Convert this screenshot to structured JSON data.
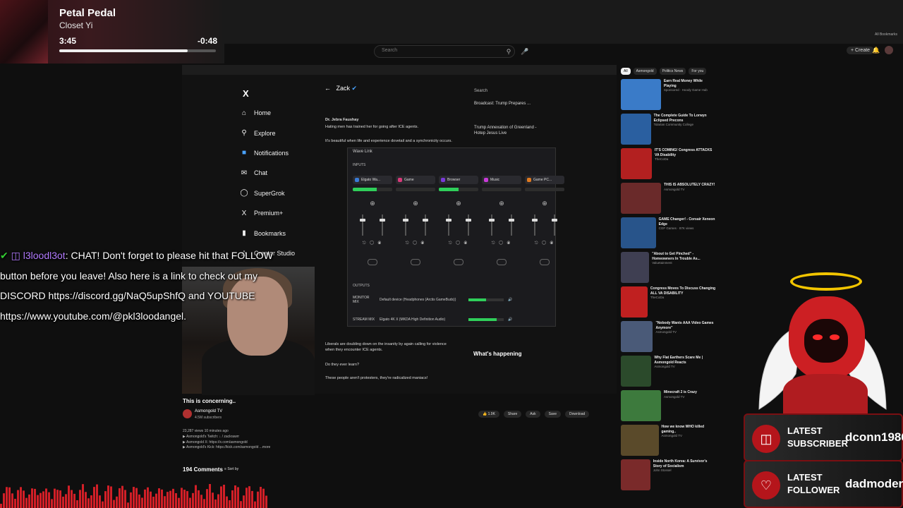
{
  "now_playing": {
    "title": "Petal Pedal",
    "artist": "Closet Yi",
    "elapsed": "3:45",
    "remaining": "-0:48",
    "progress": 0.82
  },
  "youtube": {
    "search_placeholder": "Search",
    "create_label": "Create",
    "bookmarks_label": "All Bookmarks",
    "video_title": "This is concerning..",
    "channel_name": "Asmongold TV",
    "channel_subs": "4.5M subscribers",
    "like_count": "1.9K",
    "actions": [
      "Share",
      "Ask",
      "Save",
      "Download"
    ],
    "description_lines": [
      "23,287 views  10 minutes ago",
      "▶ Asmongold's Twitch: ↓ / zackrawrr",
      "▶ Asmongold X: https://x.com/asmongold",
      "▶ Asmongold's Kick: https://kick.com/asmongold ...more"
    ],
    "comments_count": "194 Comments",
    "sort_label": "Sort by",
    "chips": [
      "All",
      "Asmongold",
      "Politics News",
      "For you"
    ],
    "recommendations": [
      {
        "title": "Earn Real Money While Playing",
        "meta": "Sponsored · Hoody Game Hub",
        "color": "#3a7bc8"
      },
      {
        "title": "The Complete Guide To Lorwyn Eclipsed Precons",
        "meta": "Tolarian Community College",
        "color": "#2a5fa0"
      },
      {
        "title": "IT'S COMING! Congress ATTACKS VA Disability",
        "meta": "TheCoDa",
        "color": "#b32020"
      },
      {
        "title": "THIS IS ABSOLUTELY CRAZY!",
        "meta": "Asmongold TV",
        "color": "#6a2a2a"
      },
      {
        "title": "GAME Changer! - Corsair Xeneon Edge",
        "meta": "CGF Games · 87K views",
        "color": "#28548a"
      },
      {
        "title": "\"About to Get Pinched\" - Homeowners In Trouble As...",
        "meta": "Valuetainment",
        "color": "#3f3f52"
      },
      {
        "title": "Congress Moves To Discuss Changing ALL VA DISABILITY",
        "meta": "TheCoDa",
        "color": "#c02020"
      },
      {
        "title": "\"Nobody Wants AAA Video Games Anymore\"",
        "meta": "Asmongold TV",
        "color": "#4a5a78"
      },
      {
        "title": "Why Flat Earthers Scare Me | Asmongold Reacts",
        "meta": "Asmongold TV",
        "color": "#2b4a2b"
      },
      {
        "title": "Minecraft 2 is Crazy",
        "meta": "Asmongold TV",
        "color": "#3d7a3d"
      },
      {
        "title": "How we know WHO killed gaming..",
        "meta": "Asmongold TV",
        "color": "#5a4a2a"
      },
      {
        "title": "Inside North Korea: A Survivor's Story of Socialism",
        "meta": "John Stossel",
        "color": "#7a2a2a"
      }
    ]
  },
  "x_app": {
    "nav": [
      "Home",
      "Explore",
      "Notifications",
      "Chat",
      "SuperGrok",
      "Premium+",
      "Bookmarks",
      "Creator Studio"
    ],
    "profile_name": "Zack",
    "search_label": "Search",
    "tweet_author": "Dr. Jebra Faushay",
    "tweet_text": "Hating men has trained her for going after ICE agents.",
    "tweet_text2": "It's beautiful when life and experience dovetail and a synchronicity occurs.",
    "tweet_text3": "Liberals are doubling down on the insanity by again calling for violence when they encounter ICE agents.",
    "tweet_text4": "Do they ever learn?",
    "tweet_text5": "These people aren't protesters, they're radicalized maniacs!",
    "news1": "Broadcast: Trump Prepares ...",
    "news2": "Trump Annexation of Greenland - Hotep Jesus Live",
    "whats_happening": "What's happening"
  },
  "wave_link": {
    "window_title": "Wave Link",
    "inputs_label": "INPUTS",
    "outputs_label": "OUTPUTS",
    "channels": [
      {
        "name": "Elgato Wa...",
        "color": "#3a7bd5",
        "meter": 0.6
      },
      {
        "name": "Game",
        "color": "#d83a7a",
        "meter": 0.0
      },
      {
        "name": "Browser",
        "color": "#7a3ad8",
        "meter": 0.5
      },
      {
        "name": "Music",
        "color": "#c83ad8",
        "meter": 0.0
      },
      {
        "name": "Game PC...",
        "color": "#e07a20",
        "meter": 0.0
      }
    ],
    "outputs": [
      {
        "label": "MONITOR MIX",
        "device": "Default device (Headphones (Arctis GameBuds))",
        "meter": 0.5
      },
      {
        "label": "STREAM MIX",
        "device": "Elgato 4K X (MKDA High Definition Audio)",
        "meter": 0.8
      }
    ]
  },
  "chat": {
    "username": "l3loodl3ot",
    "message": ": CHAT! Don't forget to please hit that FOLLOW button before you leave! Also here is a link to check out my DISCORD https://discord.gg/NaQ5upShfQ and YOUTUBE https://www.youtube.com/@pkl3loodangel."
  },
  "latest": {
    "subscriber_label": "LATEST SUBSCRIBER",
    "subscriber_name": "dconn1986",
    "follower_label": "LATEST FOLLOWER",
    "follower_name": "dadmodern"
  }
}
